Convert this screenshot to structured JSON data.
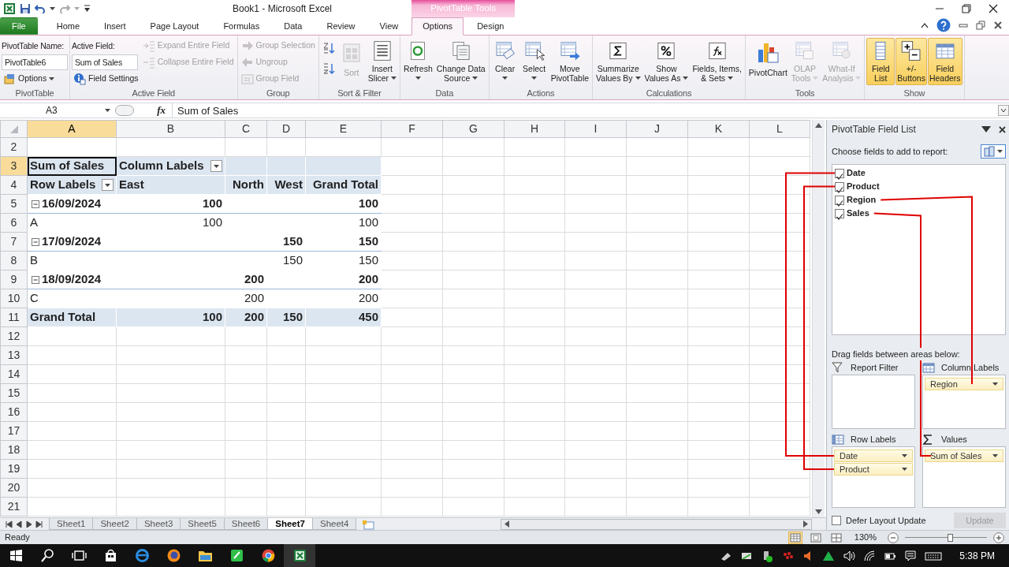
{
  "window": {
    "title": "Book1  -  Microsoft Excel",
    "context_label": "PivotTable Tools"
  },
  "ribbon_tabs": [
    {
      "label": "File",
      "kind": "file",
      "selected": false
    },
    {
      "label": "Home",
      "kind": "tab",
      "selected": false
    },
    {
      "label": "Insert",
      "kind": "tab",
      "selected": false
    },
    {
      "label": "Page Layout",
      "kind": "tab",
      "selected": false
    },
    {
      "label": "Formulas",
      "kind": "tab",
      "selected": false
    },
    {
      "label": "Data",
      "kind": "tab",
      "selected": false
    },
    {
      "label": "Review",
      "kind": "tab",
      "selected": false
    },
    {
      "label": "View",
      "kind": "tab",
      "selected": false
    },
    {
      "label": "Options",
      "kind": "context",
      "selected": true
    },
    {
      "label": "Design",
      "kind": "context",
      "selected": false
    }
  ],
  "ribbon_groups": [
    {
      "label": "PivotTable",
      "columns": [
        [
          {
            "kind": "caption",
            "label": "PivotTable Name:"
          },
          {
            "kind": "field",
            "value": "PivotTable6"
          },
          {
            "kind": "small",
            "label": "Options",
            "dropdown": true,
            "disabled": false
          }
        ]
      ]
    },
    {
      "label": "Active Field",
      "columns": [
        [
          {
            "kind": "caption",
            "label": "Active Field:"
          },
          {
            "kind": "field",
            "value": "Sum of Sales"
          },
          {
            "kind": "small",
            "label": "Field Settings",
            "dropdown": false,
            "disabled": false
          }
        ],
        [
          {
            "kind": "small",
            "label": "Expand Entire Field",
            "dropdown": false,
            "disabled": true
          },
          {
            "kind": "small",
            "label": "Collapse Entire Field",
            "dropdown": false,
            "disabled": true
          }
        ]
      ]
    },
    {
      "label": "Group",
      "columns": [
        [
          {
            "kind": "small",
            "label": "Group Selection",
            "dropdown": false,
            "disabled": true
          },
          {
            "kind": "small",
            "label": "Ungroup",
            "dropdown": false,
            "disabled": true
          },
          {
            "kind": "small",
            "label": "Group Field",
            "dropdown": false,
            "disabled": true
          }
        ]
      ]
    },
    {
      "label": "Sort & Filter",
      "columns": [
        [
          {
            "kind": "icon",
            "disabled": false
          },
          {
            "kind": "icon",
            "disabled": false
          }
        ],
        [
          {
            "kind": "large",
            "lines": [
              "Sort"
            ],
            "dropdown": false,
            "disabled": true,
            "on": false
          }
        ],
        [
          {
            "kind": "large",
            "lines": [
              "Insert",
              "Slicer"
            ],
            "dropdown": true,
            "disabled": false,
            "on": false
          }
        ]
      ]
    },
    {
      "label": "Data",
      "columns": [
        [
          {
            "kind": "large",
            "lines": [
              "Refresh"
            ],
            "dropdown": true,
            "disabled": false,
            "on": false
          }
        ],
        [
          {
            "kind": "large",
            "lines": [
              "Change Data",
              "Source"
            ],
            "dropdown": true,
            "disabled": false,
            "on": false
          }
        ]
      ]
    },
    {
      "label": "Actions",
      "columns": [
        [
          {
            "kind": "large",
            "lines": [
              "Clear"
            ],
            "dropdown": true,
            "disabled": false,
            "on": false
          }
        ],
        [
          {
            "kind": "large",
            "lines": [
              "Select"
            ],
            "dropdown": true,
            "disabled": false,
            "on": false
          }
        ],
        [
          {
            "kind": "large",
            "lines": [
              "Move",
              "PivotTable"
            ],
            "dropdown": false,
            "disabled": false,
            "on": false
          }
        ]
      ]
    },
    {
      "label": "Calculations",
      "columns": [
        [
          {
            "kind": "large",
            "lines": [
              "Summarize",
              "Values By"
            ],
            "dropdown": true,
            "disabled": false,
            "on": false
          }
        ],
        [
          {
            "kind": "large",
            "lines": [
              "Show",
              "Values As"
            ],
            "dropdown": true,
            "disabled": false,
            "on": false
          }
        ],
        [
          {
            "kind": "large",
            "lines": [
              "Fields, Items,",
              "& Sets"
            ],
            "dropdown": true,
            "disabled": false,
            "on": false
          }
        ]
      ]
    },
    {
      "label": "Tools",
      "columns": [
        [
          {
            "kind": "large",
            "lines": [
              "PivotChart"
            ],
            "dropdown": false,
            "disabled": false,
            "on": false
          }
        ],
        [
          {
            "kind": "large",
            "lines": [
              "OLAP",
              "Tools"
            ],
            "dropdown": true,
            "disabled": true,
            "on": false
          }
        ],
        [
          {
            "kind": "large",
            "lines": [
              "What-If",
              "Analysis"
            ],
            "dropdown": true,
            "disabled": true,
            "on": false
          }
        ]
      ]
    },
    {
      "label": "Show",
      "columns": [
        [
          {
            "kind": "large",
            "lines": [
              "Field",
              "List"
            ],
            "dropdown": false,
            "disabled": false,
            "on": true
          }
        ],
        [
          {
            "kind": "large",
            "lines": [
              "+/-",
              "Buttons"
            ],
            "dropdown": false,
            "disabled": false,
            "on": true
          }
        ],
        [
          {
            "kind": "large",
            "lines": [
              "Field",
              "Headers"
            ],
            "dropdown": false,
            "disabled": false,
            "on": true
          }
        ]
      ]
    }
  ],
  "formula_bar": {
    "name_box": "A3",
    "function_label": "fx",
    "formula": "Sum of Sales"
  },
  "sheet": {
    "columns": [
      {
        "label": "A",
        "selected": true
      },
      {
        "label": "B",
        "selected": false
      },
      {
        "label": "C",
        "selected": false
      },
      {
        "label": "D",
        "selected": false
      },
      {
        "label": "E",
        "selected": false
      },
      {
        "label": "F",
        "selected": false
      },
      {
        "label": "G",
        "selected": false
      },
      {
        "label": "H",
        "selected": false
      },
      {
        "label": "I",
        "selected": false
      },
      {
        "label": "J",
        "selected": false
      },
      {
        "label": "K",
        "selected": false
      },
      {
        "label": "L",
        "selected": false
      }
    ],
    "rows": [
      {
        "number": "2",
        "kind": "blank",
        "selected": false
      },
      {
        "number": "3",
        "kind": "title",
        "selected": true,
        "cells": [
          "Sum of Sales",
          "Column Labels"
        ]
      },
      {
        "number": "4",
        "kind": "header",
        "selected": false,
        "cells": [
          "Row Labels",
          "East",
          "North",
          "West",
          "Grand Total"
        ]
      },
      {
        "number": "5",
        "kind": "date",
        "selected": false,
        "expanded": true,
        "cells": [
          "16/09/2024",
          "100",
          null,
          null,
          "100"
        ]
      },
      {
        "number": "6",
        "kind": "item",
        "selected": false,
        "cells": [
          "A",
          "100",
          null,
          null,
          "100"
        ]
      },
      {
        "number": "7",
        "kind": "date",
        "selected": false,
        "expanded": true,
        "cells": [
          "17/09/2024",
          null,
          null,
          "150",
          "150"
        ]
      },
      {
        "number": "8",
        "kind": "item",
        "selected": false,
        "cells": [
          "B",
          null,
          null,
          "150",
          "150"
        ]
      },
      {
        "number": "9",
        "kind": "date",
        "selected": false,
        "expanded": true,
        "cells": [
          "18/09/2024",
          null,
          "200",
          null,
          "200"
        ]
      },
      {
        "number": "10",
        "kind": "item",
        "selected": false,
        "cells": [
          "C",
          null,
          "200",
          null,
          "200"
        ]
      },
      {
        "number": "11",
        "kind": "total",
        "selected": false,
        "cells": [
          "Grand Total",
          "100",
          "200",
          "150",
          "450"
        ]
      },
      {
        "number": "12",
        "kind": "blank",
        "selected": false
      },
      {
        "number": "13",
        "kind": "blank",
        "selected": false
      },
      {
        "number": "14",
        "kind": "blank",
        "selected": false
      },
      {
        "number": "15",
        "kind": "blank",
        "selected": false
      },
      {
        "number": "16",
        "kind": "blank",
        "selected": false
      },
      {
        "number": "17",
        "kind": "blank",
        "selected": false
      },
      {
        "number": "18",
        "kind": "blank",
        "selected": false
      },
      {
        "number": "19",
        "kind": "blank",
        "selected": false
      },
      {
        "number": "20",
        "kind": "blank",
        "selected": false
      },
      {
        "number": "21",
        "kind": "blank",
        "selected": false
      }
    ]
  },
  "sheet_tabs": [
    {
      "label": "Sheet1",
      "selected": false
    },
    {
      "label": "Sheet2",
      "selected": false
    },
    {
      "label": "Sheet3",
      "selected": false
    },
    {
      "label": "Sheet5",
      "selected": false
    },
    {
      "label": "Sheet6",
      "selected": false
    },
    {
      "label": "Sheet7",
      "selected": true
    },
    {
      "label": "Sheet4",
      "selected": false
    }
  ],
  "field_list": {
    "title": "PivotTable Field List",
    "prompt": "Choose fields to add to report:",
    "fields": [
      {
        "label": "Date",
        "checked": true
      },
      {
        "label": "Product",
        "checked": true
      },
      {
        "label": "Region",
        "checked": true
      },
      {
        "label": "Sales",
        "checked": true
      }
    ],
    "areas_prompt": "Drag fields between areas below:",
    "areas": [
      {
        "label": "Report Filter",
        "kind": "filter"
      },
      {
        "label": "Column Labels",
        "kind": "columns",
        "items": [
          "Region"
        ]
      },
      {
        "label": "Row Labels",
        "kind": "rows",
        "items": [
          "Date",
          "Product"
        ]
      },
      {
        "label": "Values",
        "kind": "values",
        "items": [
          "Sum of Sales"
        ]
      }
    ],
    "defer": {
      "label": "Defer Layout Update",
      "checked": false
    },
    "update_button": {
      "label": "Update",
      "disabled": true
    }
  },
  "status_bar": {
    "text": "Ready",
    "views": [
      {
        "selected": true
      },
      {
        "selected": false
      },
      {
        "selected": false
      }
    ],
    "zoom": {
      "reading": "130%",
      "level": 0.55
    }
  },
  "taskbar": {
    "time": "5:38 PM"
  }
}
